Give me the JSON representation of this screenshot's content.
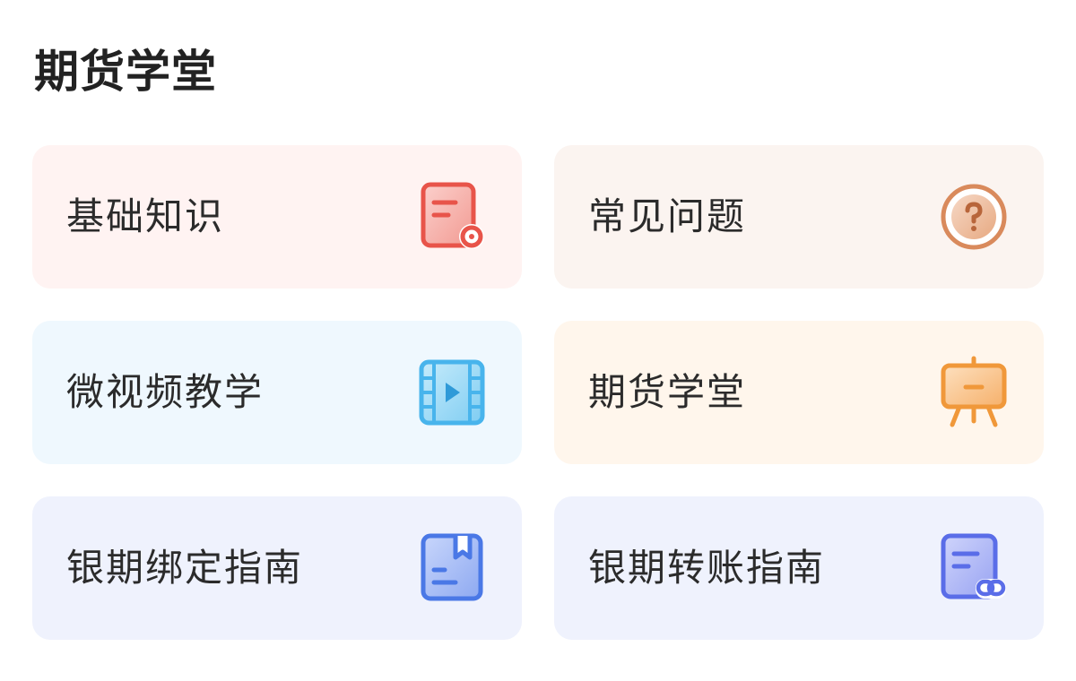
{
  "section": {
    "title": "期货学堂"
  },
  "cards": [
    {
      "label": "基础知识",
      "icon": "document-coin-icon",
      "bg": "#fff3f2",
      "accent": "#e8544a"
    },
    {
      "label": "常见问题",
      "icon": "question-circle-icon",
      "bg": "#fbf4f0",
      "accent": "#d98a5c"
    },
    {
      "label": "微视频教学",
      "icon": "film-play-icon",
      "bg": "#eff8fe",
      "accent": "#48b4ec"
    },
    {
      "label": "期货学堂",
      "icon": "easel-board-icon",
      "bg": "#fff6ec",
      "accent": "#f0983a"
    },
    {
      "label": "银期绑定指南",
      "icon": "bookmark-book-icon",
      "bg": "#eff2fd",
      "accent": "#4a78e6"
    },
    {
      "label": "银期转账指南",
      "icon": "document-link-icon",
      "bg": "#eff2fd",
      "accent": "#5a6de8"
    }
  ]
}
